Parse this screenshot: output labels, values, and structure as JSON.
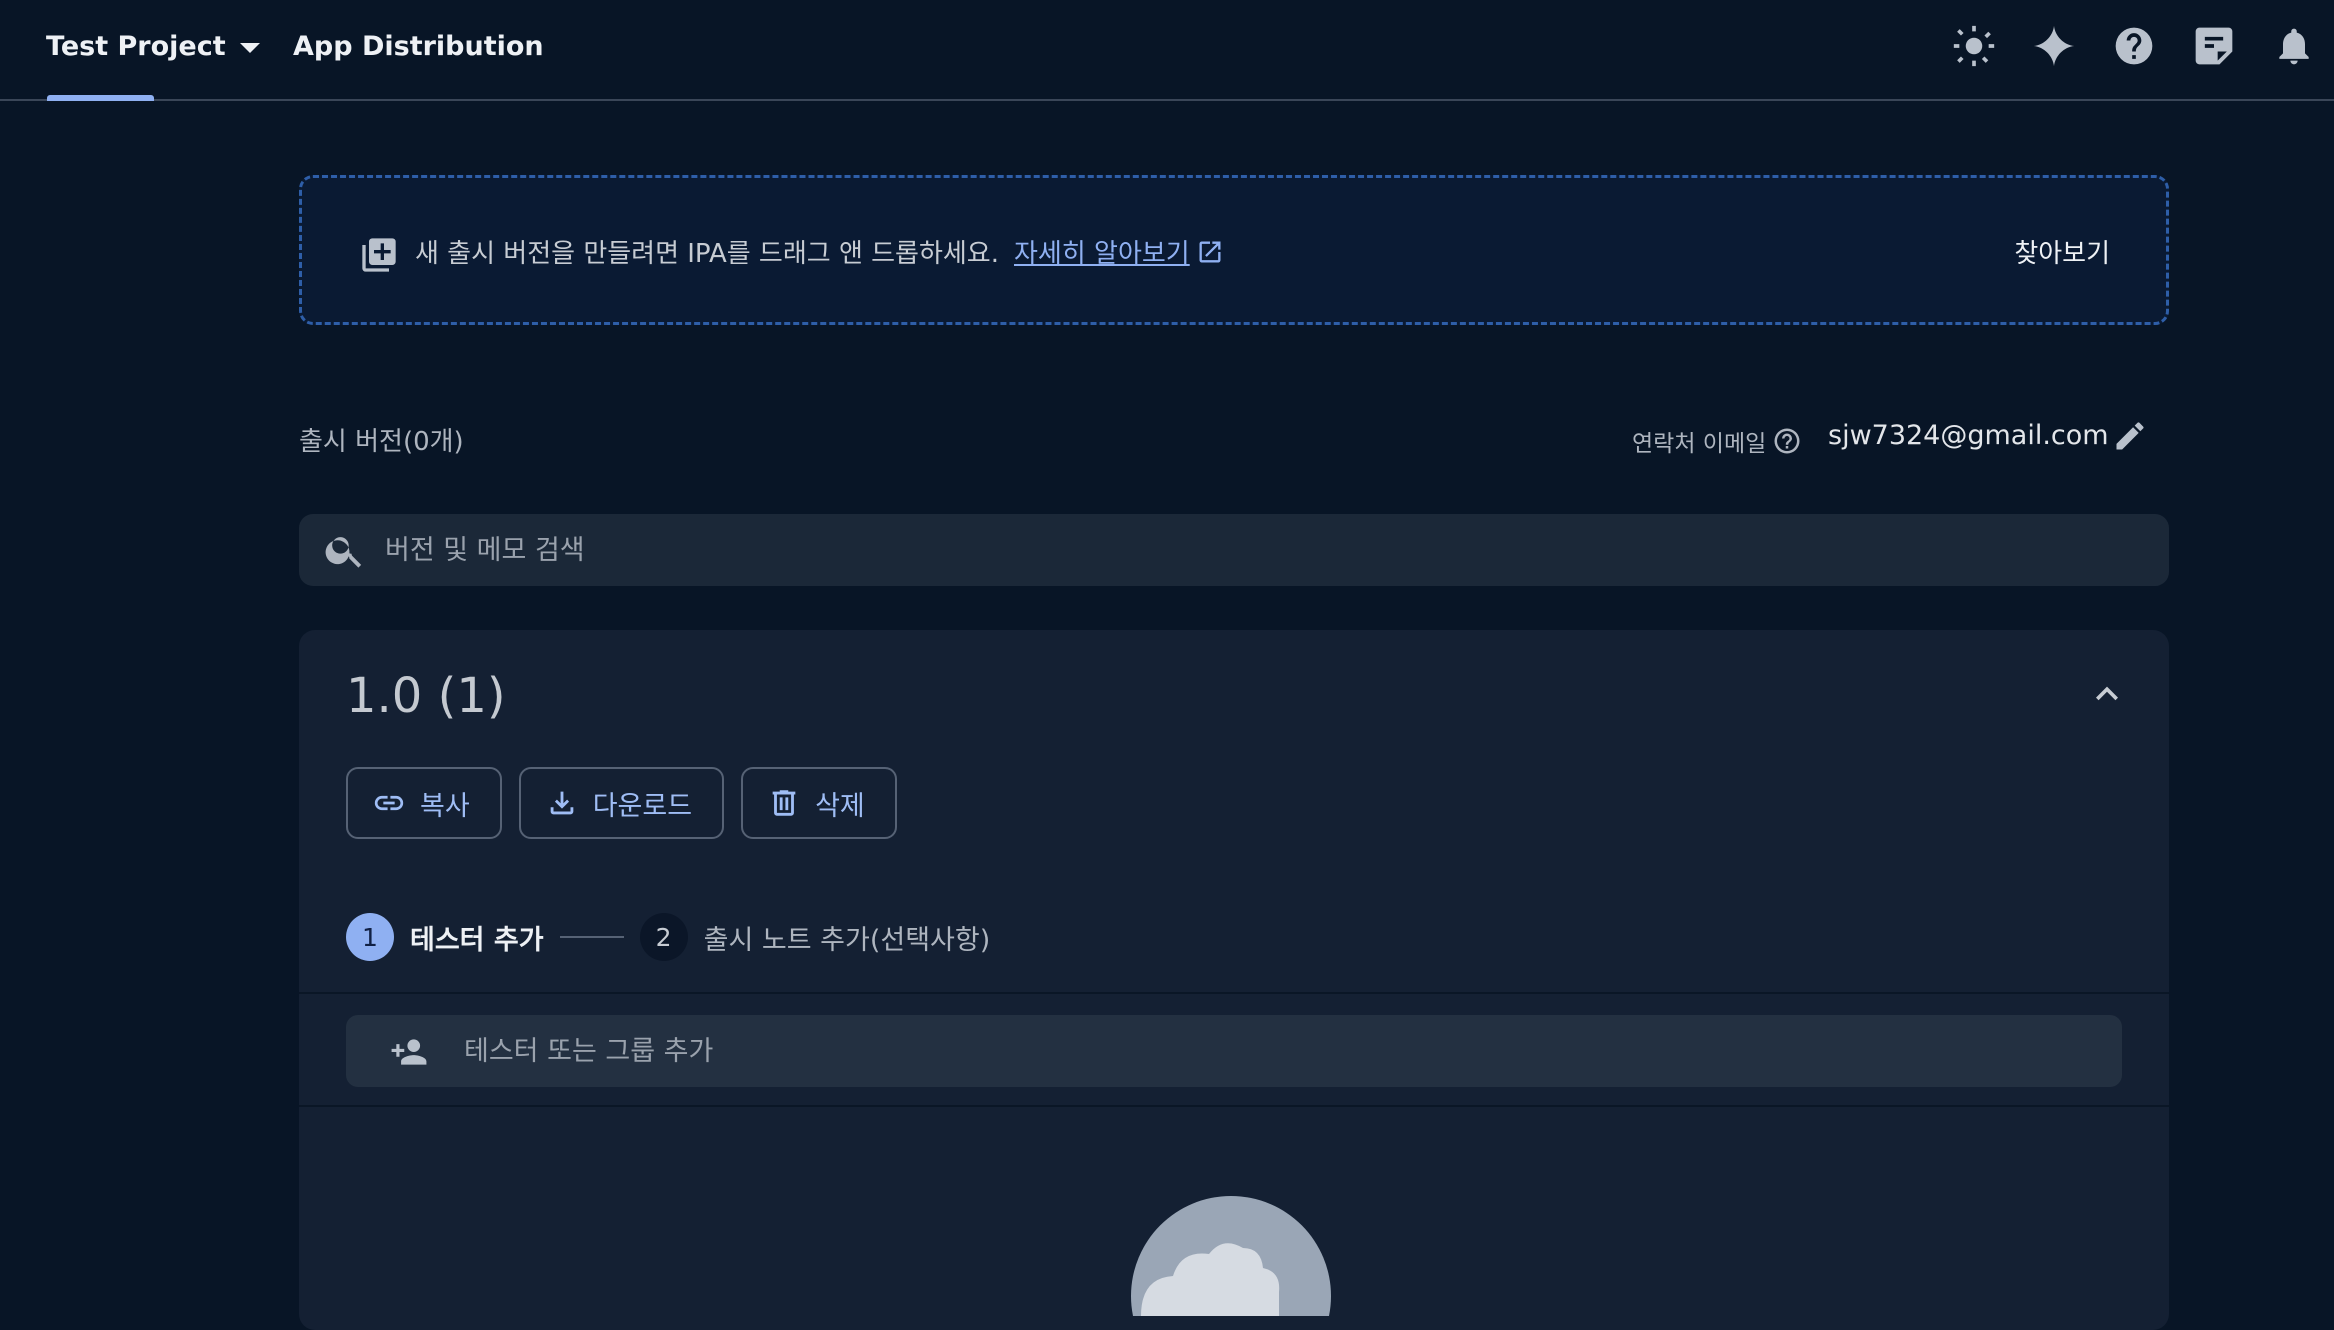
{
  "header": {
    "project_name": "Test Project",
    "section_title": "App Distribution",
    "icons": [
      "theme-toggle-icon",
      "gemini-sparkle-icon",
      "help-icon",
      "feedback-icon",
      "notifications-icon"
    ]
  },
  "dropzone": {
    "message": "새 출시 버전을 만들려면 IPA를 드래그 앤 드롭하세요.",
    "learn_more": "자세히 알아보기",
    "browse": "찾아보기"
  },
  "releases": {
    "count_label": "출시 버전(0개)",
    "contact_label": "연락처 이메일",
    "contact_email": "sjw7324@gmail.com"
  },
  "search": {
    "placeholder": "버전 및 메모 검색"
  },
  "release_card": {
    "version": "1.0 (1)",
    "actions": {
      "copy": "복사",
      "download": "다운로드",
      "delete": "삭제"
    },
    "steps": [
      {
        "number": "1",
        "label": "테스터 추가"
      },
      {
        "number": "2",
        "label": "출시 노트 추가(선택사항)"
      }
    ],
    "tester_placeholder": "테스터 또는 그룹 추가"
  },
  "colors": {
    "background": "#081526",
    "card": "#142033",
    "accent": "#8fb0f2",
    "dropzone_border": "#2e5ea8"
  }
}
